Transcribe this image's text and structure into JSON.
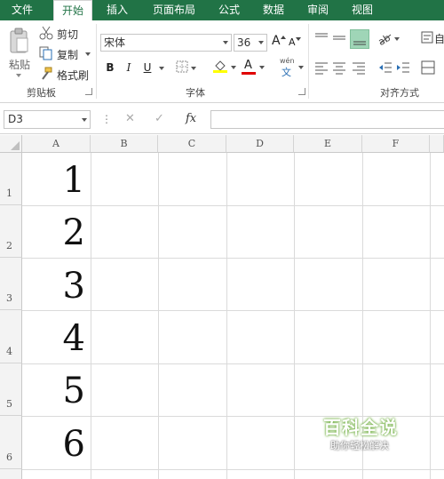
{
  "tabs": [
    {
      "label": "文件"
    },
    {
      "label": "开始"
    },
    {
      "label": "插入"
    },
    {
      "label": "页面布局"
    },
    {
      "label": "公式"
    },
    {
      "label": "数据"
    },
    {
      "label": "审阅"
    },
    {
      "label": "视图"
    }
  ],
  "clipboard": {
    "paste_label": "粘贴",
    "cut_label": "剪切",
    "copy_label": "复制",
    "format_painter_label": "格式刷",
    "group_label": "剪贴板"
  },
  "font": {
    "family": "宋体",
    "size": "36",
    "bold": "B",
    "italic": "I",
    "underline": "U",
    "grow": "A",
    "shrink": "A",
    "font_color_glyph": "A",
    "wen_top": "wén",
    "wen_bottom": "文",
    "group_label": "字体"
  },
  "alignment": {
    "group_label": "对齐方式",
    "wrap_label": "自"
  },
  "formula_bar": {
    "name_box": "D3",
    "fx": "fx",
    "formula": ""
  },
  "columns": [
    "A",
    "B",
    "C",
    "D",
    "E",
    "F"
  ],
  "rows": [
    {
      "num": "1",
      "A": "1"
    },
    {
      "num": "2",
      "A": "2"
    },
    {
      "num": "3",
      "A": "3"
    },
    {
      "num": "4",
      "A": "4"
    },
    {
      "num": "5",
      "A": "5"
    },
    {
      "num": "6",
      "A": "6"
    }
  ],
  "watermark": {
    "title": "百科全说",
    "subtitle": "助你轻松解决"
  },
  "colors": {
    "brand": "#217346",
    "fill_highlight": "#ffff00",
    "font_red": "#e00000"
  }
}
